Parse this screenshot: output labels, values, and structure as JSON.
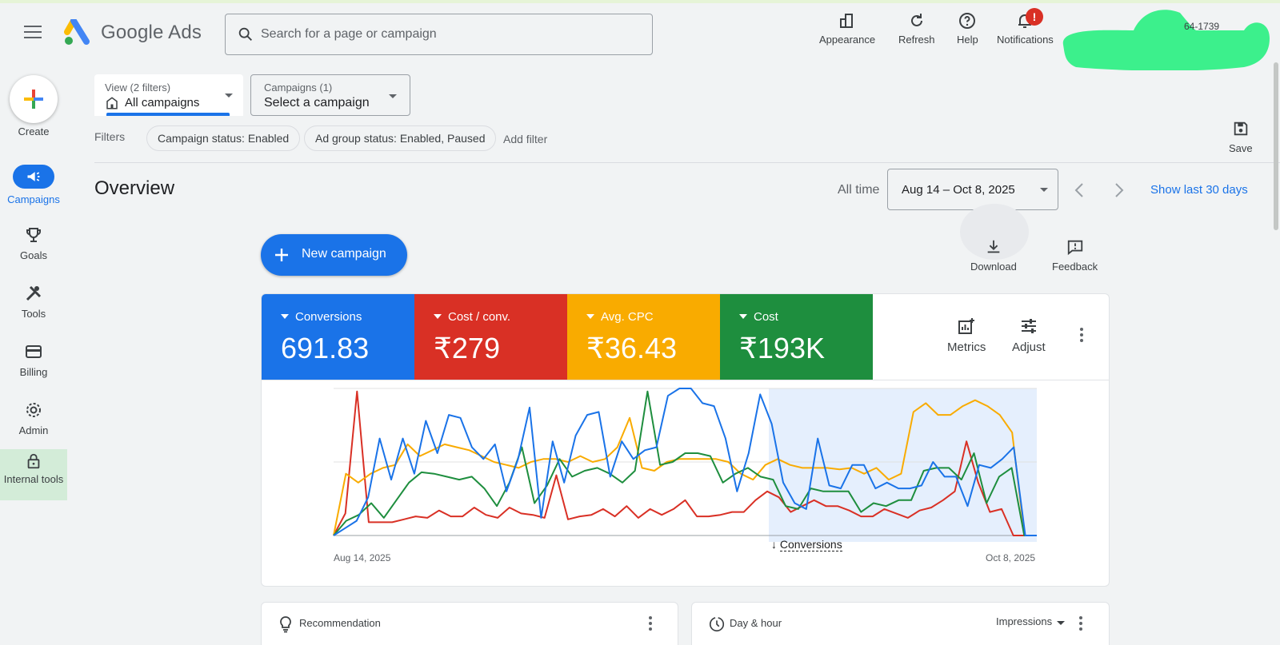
{
  "app": {
    "brand": "Google Ads"
  },
  "search": {
    "placeholder": "Search for a page or campaign"
  },
  "topbar": {
    "appearance": "Appearance",
    "refresh": "Refresh",
    "help": "Help",
    "notifications": "Notifications",
    "notifications_badge": "!",
    "account_suffix": "64-1739"
  },
  "nav": {
    "create": "Create",
    "items": [
      {
        "label": "Campaigns"
      },
      {
        "label": "Goals"
      },
      {
        "label": "Tools"
      },
      {
        "label": "Billing"
      },
      {
        "label": "Admin"
      },
      {
        "label": "Internal tools"
      }
    ]
  },
  "filters": {
    "view_small": "View (2 filters)",
    "view_value": "All campaigns",
    "campaigns_small": "Campaigns (1)",
    "campaigns_value": "Select a campaign",
    "label": "Filters",
    "chips": [
      "Campaign status: Enabled",
      "Ad group status: Enabled, Paused"
    ],
    "add_filter": "Add filter",
    "save": "Save"
  },
  "overview": {
    "title": "Overview",
    "all_time": "All time",
    "date_range": "Aug 14 – Oct 8, 2025",
    "show_last": "Show last 30 days",
    "new_campaign": "New campaign",
    "download": "Download",
    "feedback": "Feedback"
  },
  "metrics": {
    "tiles": [
      {
        "label": "Conversions",
        "value": "691.83",
        "color": "#1a73e8"
      },
      {
        "label": "Cost / conv.",
        "value": "₹279",
        "color": "#d93025"
      },
      {
        "label": "Avg. CPC",
        "value": "₹36.43",
        "color": "#f9ab00"
      },
      {
        "label": "Cost",
        "value": "₹193K",
        "color": "#1e8e3e"
      }
    ],
    "metrics_btn": "Metrics",
    "adjust_btn": "Adjust"
  },
  "chart_data": {
    "type": "line",
    "x_start": "Aug 14, 2025",
    "x_end": "Oct 8, 2025",
    "annotation": "Conversions",
    "series": [
      {
        "color": "#1a73e8",
        "values": [
          0.0,
          0.05,
          0.1,
          0.26,
          0.66,
          0.38,
          0.66,
          0.42,
          0.78,
          0.56,
          0.82,
          0.8,
          0.6,
          0.52,
          0.62,
          0.3,
          0.52,
          0.87,
          0.12,
          0.64,
          0.36,
          0.68,
          0.82,
          0.84,
          0.4,
          0.64,
          0.52,
          0.58,
          0.6,
          0.95,
          1.0,
          1.0,
          0.9,
          0.88,
          0.66,
          0.3,
          0.56,
          0.96,
          0.76,
          0.36,
          0.22,
          0.18,
          0.66,
          0.34,
          0.32,
          0.48,
          0.48,
          0.32,
          0.36,
          0.32,
          0.32,
          0.34,
          0.5,
          0.4,
          0.4,
          0.2,
          0.48,
          0.46,
          0.52,
          0.6,
          0.0,
          0.0
        ]
      },
      {
        "color": "#d93025",
        "values": [
          0.0,
          0.15,
          0.98,
          0.09,
          0.09,
          0.09,
          0.11,
          0.13,
          0.12,
          0.17,
          0.13,
          0.13,
          0.19,
          0.14,
          0.12,
          0.19,
          0.15,
          0.14,
          0.12,
          0.41,
          0.11,
          0.13,
          0.14,
          0.18,
          0.13,
          0.2,
          0.12,
          0.18,
          0.14,
          0.18,
          0.24,
          0.13,
          0.13,
          0.14,
          0.16,
          0.16,
          0.24,
          0.3,
          0.26,
          0.16,
          0.2,
          0.24,
          0.2,
          0.2,
          0.17,
          0.13,
          0.13,
          0.18,
          0.15,
          0.12,
          0.17,
          0.19,
          0.24,
          0.3,
          0.64,
          0.36,
          0.16,
          0.18,
          0.0,
          0.0,
          0.0
        ]
      },
      {
        "color": "#f9ab00",
        "values": [
          0.0,
          0.42,
          0.36,
          0.42,
          0.46,
          0.48,
          0.62,
          0.54,
          0.58,
          0.62,
          0.6,
          0.58,
          0.54,
          0.5,
          0.48,
          0.46,
          0.5,
          0.52,
          0.52,
          0.5,
          0.54,
          0.5,
          0.52,
          0.6,
          0.8,
          0.46,
          0.44,
          0.5,
          0.52,
          0.52,
          0.52,
          0.52,
          0.5,
          0.42,
          0.38,
          0.48,
          0.52,
          0.48,
          0.46,
          0.46,
          0.46,
          0.45,
          0.46,
          0.42,
          0.46,
          0.38,
          0.42,
          0.84,
          0.9,
          0.82,
          0.82,
          0.88,
          0.92,
          0.88,
          0.82,
          0.7,
          0.0,
          0.0
        ]
      },
      {
        "color": "#1e8e3e",
        "values": [
          0.0,
          0.1,
          0.14,
          0.22,
          0.12,
          0.24,
          0.36,
          0.43,
          0.42,
          0.4,
          0.38,
          0.4,
          0.32,
          0.2,
          0.36,
          0.6,
          0.22,
          0.34,
          0.52,
          0.4,
          0.44,
          0.46,
          0.42,
          0.36,
          0.44,
          0.98,
          0.48,
          0.5,
          0.56,
          0.56,
          0.54,
          0.36,
          0.42,
          0.46,
          0.4,
          0.38,
          0.2,
          0.18,
          0.32,
          0.3,
          0.3,
          0.3,
          0.16,
          0.22,
          0.2,
          0.24,
          0.24,
          0.44,
          0.46,
          0.46,
          0.38,
          0.56,
          0.22,
          0.4,
          0.46,
          0.0,
          0.0
        ]
      }
    ]
  },
  "bottom": {
    "recommendation": "Recommendation",
    "day_hour": "Day & hour",
    "impressions": "Impressions"
  },
  "colors": {
    "accent": "#1a73e8",
    "nav_internal_bg": "#d3ecd8"
  }
}
